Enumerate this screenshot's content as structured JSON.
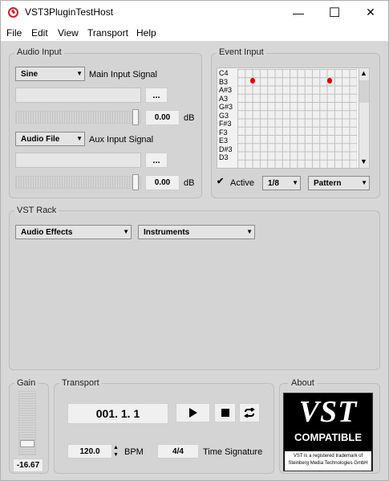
{
  "window": {
    "title": "VST3PluginTestHost",
    "minimize": "—",
    "maximize": "☐",
    "close": "✕"
  },
  "menu": [
    "File",
    "Edit",
    "View",
    "Transport",
    "Help"
  ],
  "audio_input": {
    "title": "Audio Input",
    "main_source": "Sine",
    "main_label": "Main Input Signal",
    "browse": "...",
    "main_gain": "0.00",
    "db": "dB",
    "aux_source": "Audio File",
    "aux_label": "Aux Input Signal",
    "aux_gain": "0.00"
  },
  "event_input": {
    "title": "Event Input",
    "keys": [
      "C4",
      "B3",
      "A#3",
      "A3",
      "G#3",
      "G3",
      "F#3",
      "F3",
      "E3",
      "D#3",
      "D3"
    ],
    "active_label": "Active",
    "active_checked": true,
    "rate": "1/8",
    "mode": "Pattern",
    "scroll_up": "▲",
    "scroll_down": "▼"
  },
  "vst_rack": {
    "title": "VST Rack",
    "category": "Audio Effects",
    "subcategory": "Instruments"
  },
  "gain": {
    "title": "Gain",
    "value": "-16.67"
  },
  "transport": {
    "title": "Transport",
    "position": "001.  1. 1",
    "tempo": "120.0",
    "bpm_label": "BPM",
    "time_signature": "4/4",
    "ts_label": "Time Signature"
  },
  "about": {
    "title": "About",
    "logo_text": "VST",
    "compatible": "COMPATIBLE",
    "trademark_line1": "VST is a registered trademark of",
    "trademark_line2": "Steinberg Media Technologies GmbH"
  }
}
